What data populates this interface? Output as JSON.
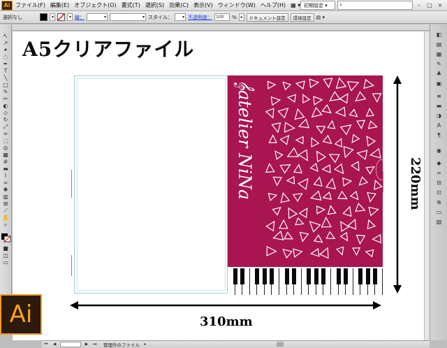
{
  "app": {
    "logo_small": "Ai",
    "logo_large": "Ai",
    "menus": [
      "ファイル(F)",
      "編集(E)",
      "オブジェクト(O)",
      "書式(T)",
      "選択(S)",
      "効果(C)",
      "表示(V)",
      "ウィンドウ(W)",
      "ヘルプ(H)"
    ],
    "workspace": "初期設定",
    "window_controls": [
      "–",
      "□",
      "×"
    ]
  },
  "control_bar": {
    "selection_label": "選択なし",
    "stroke_label": "線：",
    "style_label": "スタイル：",
    "opacity_label": "不透明度：",
    "opacity_value": "100",
    "opacity_unit": "%",
    "document_settings": "ドキュメント設定",
    "preferences": "環境設定"
  },
  "artwork": {
    "title": "A5クリアファイル",
    "brand": "𝄞atelier NiNa",
    "width_label": "310mm",
    "height_label": "220mm",
    "accent_color": "#a81550"
  },
  "status_bar": {
    "label": "管理外のファイル"
  }
}
